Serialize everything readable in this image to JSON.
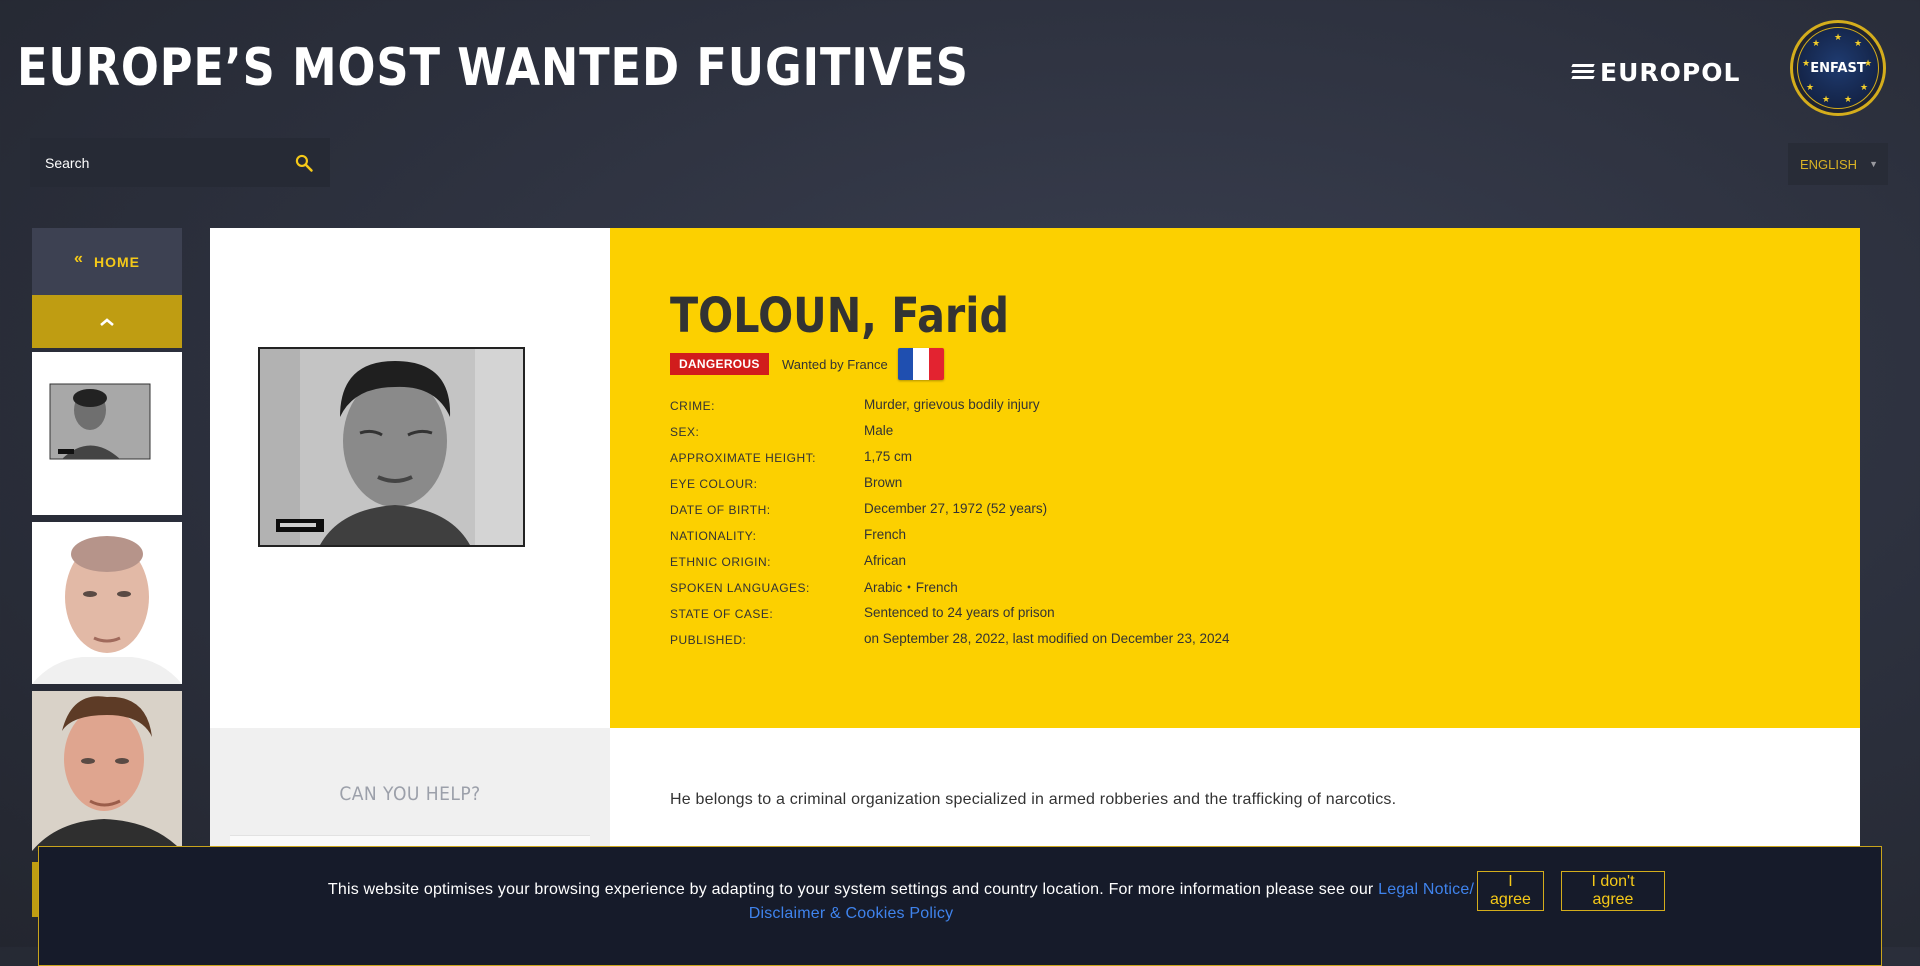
{
  "header": {
    "site_title": "EUROPE’S MOST WANTED FUGITIVES",
    "europol_logo_text": "EUROPOL",
    "enfast_logo_text": "ENFAST"
  },
  "search": {
    "placeholder": "Search",
    "icon": "search-icon"
  },
  "language": {
    "selected": "ENGLISH"
  },
  "sidebar": {
    "home_label": "HOME"
  },
  "profile": {
    "name": "TOLOUN, Farid",
    "badge": "DANGEROUS",
    "wanted_by": "Wanted by France",
    "facts": [
      {
        "label": "CRIME:",
        "value": "Murder, grievous bodily injury"
      },
      {
        "label": "SEX:",
        "value": "Male"
      },
      {
        "label": "APPROXIMATE HEIGHT:",
        "value": "1,75 cm"
      },
      {
        "label": "EYE COLOUR:",
        "value": "Brown"
      },
      {
        "label": "DATE OF BIRTH:",
        "value": "December 27, 1972 (52 years)"
      },
      {
        "label": "NATIONALITY:",
        "value": "French"
      },
      {
        "label": "ETHNIC ORIGIN:",
        "value": "African"
      },
      {
        "label": "SPOKEN LANGUAGES:",
        "value": "Arabic・French"
      },
      {
        "label": "STATE OF CASE:",
        "value": "Sentenced to 24 years of prison"
      },
      {
        "label": "PUBLISHED:",
        "value": "on September 28, 2022, last modified on December 23, 2024"
      }
    ],
    "description": "He belongs to a criminal organization specialized in armed robberies and the trafficking of narcotics."
  },
  "help": {
    "title": "CAN YOU HELP?"
  },
  "cookie": {
    "text": "This website optimises your browsing experience by adapting to your system settings and country location. For more information please see our",
    "link_part1": "Legal Notice/",
    "link_part2": "Disclaimer & Cookies Policy",
    "agree_label": "I agree",
    "disagree_label": "I don't agree"
  },
  "colors": {
    "accent_yellow": "#fcd000",
    "danger_red": "#d11c1c",
    "link_blue": "#3f83ec",
    "background": "#2c303d"
  }
}
